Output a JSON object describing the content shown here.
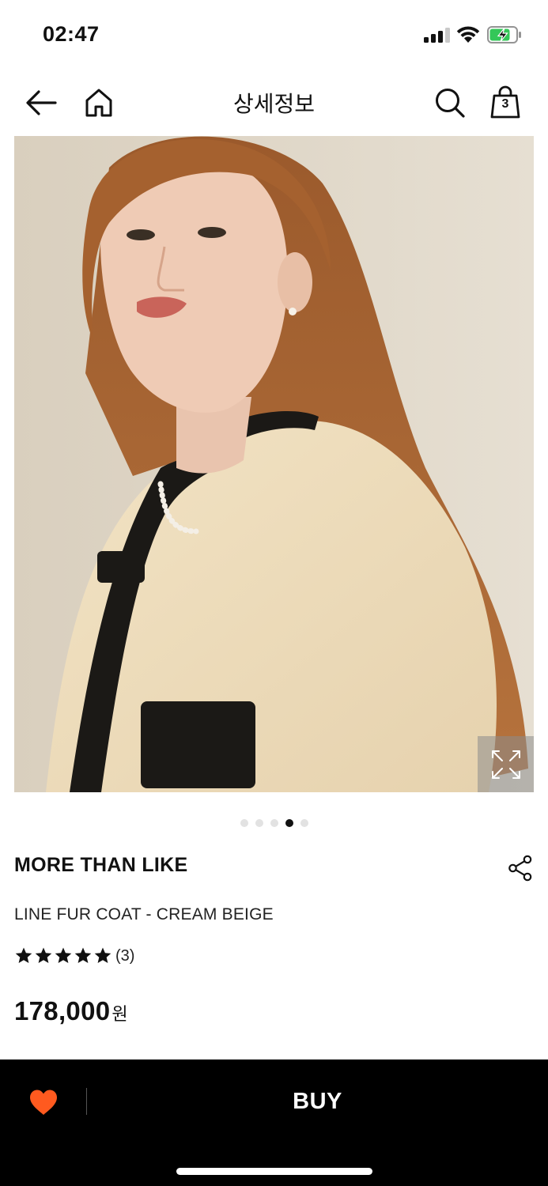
{
  "status_bar": {
    "time": "02:47",
    "icons": [
      "cellular-signal-icon",
      "wifi-icon",
      "battery-charging-icon"
    ]
  },
  "header": {
    "title": "상세정보",
    "cart_count": "3",
    "icons": [
      "back-arrow-icon",
      "home-icon",
      "search-icon",
      "shopping-bag-icon"
    ]
  },
  "gallery": {
    "image_alt": "Model wearing cream beige fur coat with black trim",
    "total_slides": 5,
    "active_slide": 4,
    "expand_icon": "expand-icon"
  },
  "product": {
    "brand": "MORE THAN LIKE",
    "name": "LINE FUR COAT - CREAM BEIGE",
    "rating_stars": 5,
    "review_count": "(3)",
    "price": "178,000",
    "currency": "원"
  },
  "bottom_bar": {
    "buy_label": "BUY",
    "wish_icon": "heart-icon",
    "wish_color": "#ff5a1f"
  },
  "colors": {
    "accent": "#ff5a1f",
    "bottom_bar_bg": "#000000",
    "pager_active": "#111111",
    "pager_inactive": "#e2e2e2"
  }
}
